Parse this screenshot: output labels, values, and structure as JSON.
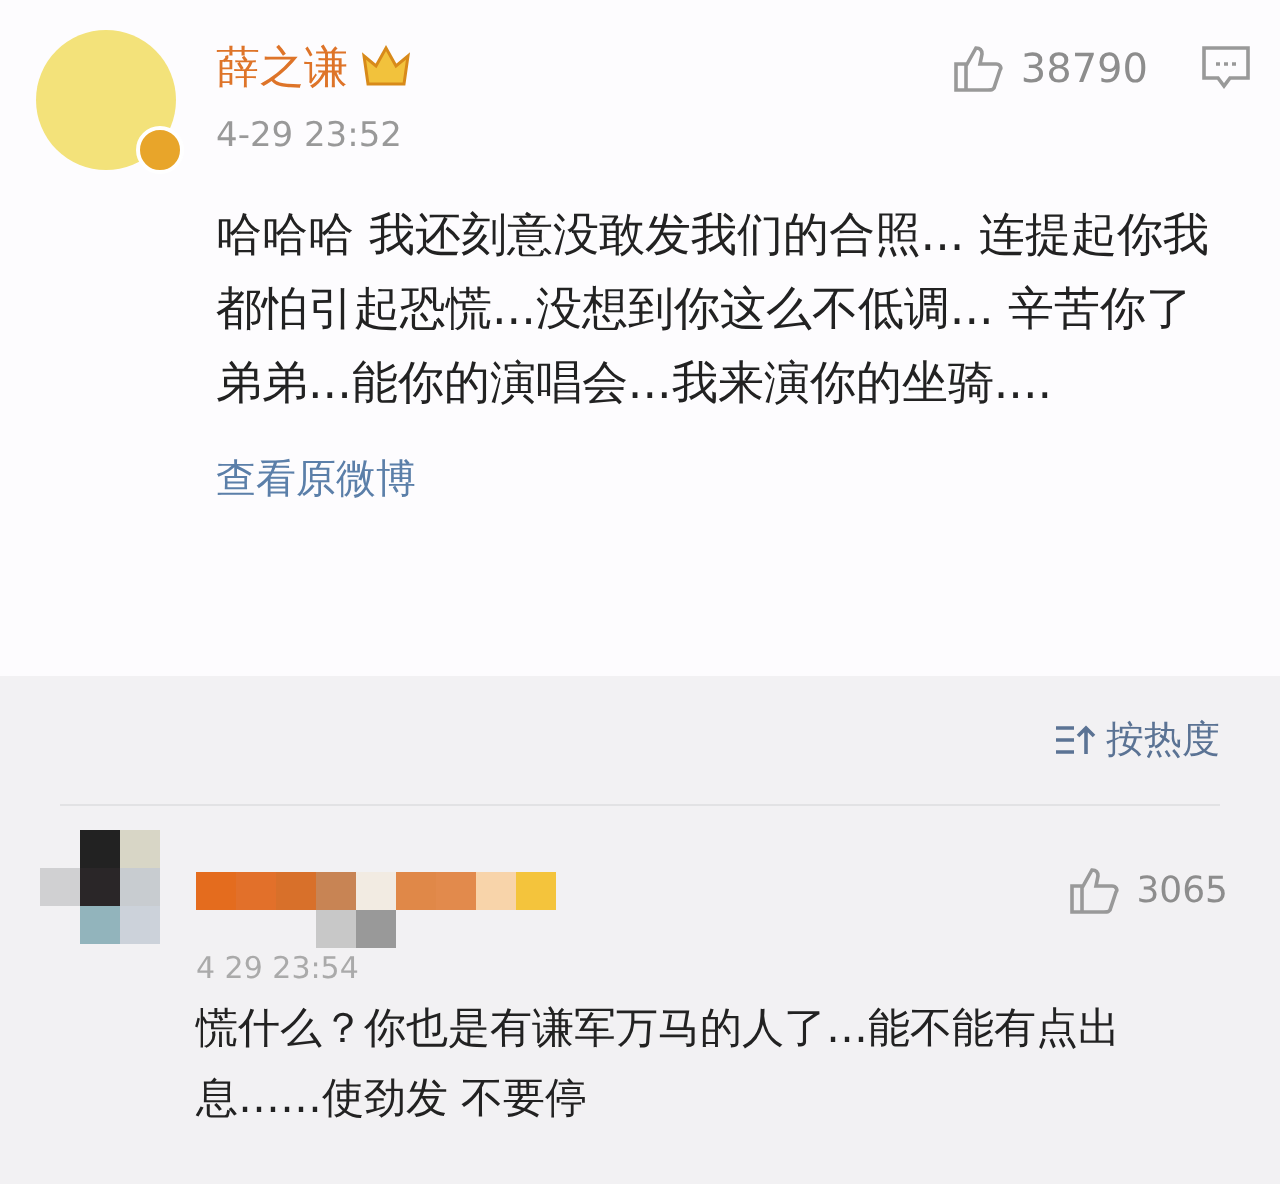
{
  "post": {
    "author": "薛之谦",
    "time": "4-29 23:52",
    "likes": "38790",
    "text": "哈哈哈 我还刻意没敢发我们的合照... 连提起你我都怕引起恐慌...没想到你这么不低调... 辛苦你了弟弟...能你的演唱会...我来演你的坐骑....",
    "link": "查看原微博"
  },
  "sort": {
    "label": "按热度"
  },
  "comments": [
    {
      "time": "4 29 23:54",
      "likes": "3065",
      "text": "慌什么？你也是有谦军万马的人了…能不能有点出息……使劲发 不要停"
    }
  ]
}
